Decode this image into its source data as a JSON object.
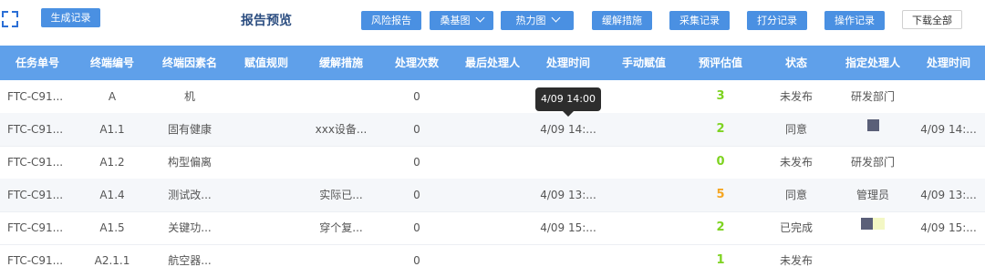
{
  "toolbar": {
    "generate_label": "生成记录",
    "title": "报告预览",
    "risk_report_label": "风险报告",
    "sankey_label": "桑基图",
    "heatmap_label": "热力图",
    "mitigation_label": "缓解措施",
    "collect_label": "采集记录",
    "scoring_label": "打分记录",
    "operation_label": "操作记录",
    "download_label": "下载全部"
  },
  "table": {
    "headers": [
      "任务单号",
      "终端编号",
      "终端因素名",
      "赋值规则",
      "缓解措施",
      "处理次数",
      "最后处理人",
      "处理时间",
      "手动赋值",
      "预评估值",
      "状态",
      "指定处理人",
      "处理时间"
    ],
    "rows": [
      {
        "task": "FTC-C91...",
        "terminal": "A",
        "factor": "机",
        "rule": "",
        "mitigation": "",
        "count": "0",
        "last_handler": "",
        "time": "",
        "manual": "",
        "score": "3",
        "score_color": "#7ed321",
        "status": "未发布",
        "assignee": "研发部门",
        "assignee_squares": [],
        "time2": ""
      },
      {
        "task": "FTC-C91...",
        "terminal": "A1.1",
        "factor": "固有健康",
        "rule": "",
        "mitigation": "xxx设备...",
        "count": "0",
        "last_handler": "",
        "time": "4/09 14:...",
        "manual": "",
        "score": "2",
        "score_color": "#7ed321",
        "status": "同意",
        "assignee": "",
        "assignee_squares": [
          "#5a5f78"
        ],
        "time2": "4/09 14:..."
      },
      {
        "task": "FTC-C91...",
        "terminal": "A1.2",
        "factor": "构型偏离",
        "rule": "",
        "mitigation": "",
        "count": "0",
        "last_handler": "",
        "time": "",
        "manual": "",
        "score": "0",
        "score_color": "#7ed321",
        "status": "未发布",
        "assignee": "研发部门",
        "assignee_squares": [],
        "time2": ""
      },
      {
        "task": "FTC-C91...",
        "terminal": "A1.4",
        "factor": "测试改...",
        "rule": "",
        "mitigation": "实际已...",
        "count": "0",
        "last_handler": "",
        "time": "4/09 13:...",
        "manual": "",
        "score": "5",
        "score_color": "#f5a623",
        "status": "同意",
        "assignee": "管理员",
        "assignee_squares": [],
        "time2": "4/09 13:..."
      },
      {
        "task": "FTC-C91...",
        "terminal": "A1.5",
        "factor": "关键功...",
        "rule": "",
        "mitigation": "穿个复...",
        "count": "0",
        "last_handler": "",
        "time": "4/09 15:...",
        "manual": "",
        "score": "2",
        "score_color": "#7ed321",
        "status": "已完成",
        "assignee": "",
        "assignee_squares": [
          "#5a5f78",
          "#f3f7c4"
        ],
        "time2": "4/09 15:..."
      },
      {
        "task": "FTC-C91...",
        "terminal": "A2.1.1",
        "factor": "航空器...",
        "rule": "",
        "mitigation": "",
        "count": "0",
        "last_handler": "",
        "time": "",
        "manual": "",
        "score": "1",
        "score_color": "#7ed321",
        "status": "未发布",
        "assignee": "",
        "assignee_squares": [],
        "time2": ""
      }
    ]
  },
  "tooltip": {
    "text": "4/09 14:00"
  },
  "colors": {
    "primary": "#4a90e2",
    "header_bg": "#5fa0ea",
    "title": "#2b4d80",
    "score_green": "#7ed321",
    "score_orange": "#f5a623"
  }
}
